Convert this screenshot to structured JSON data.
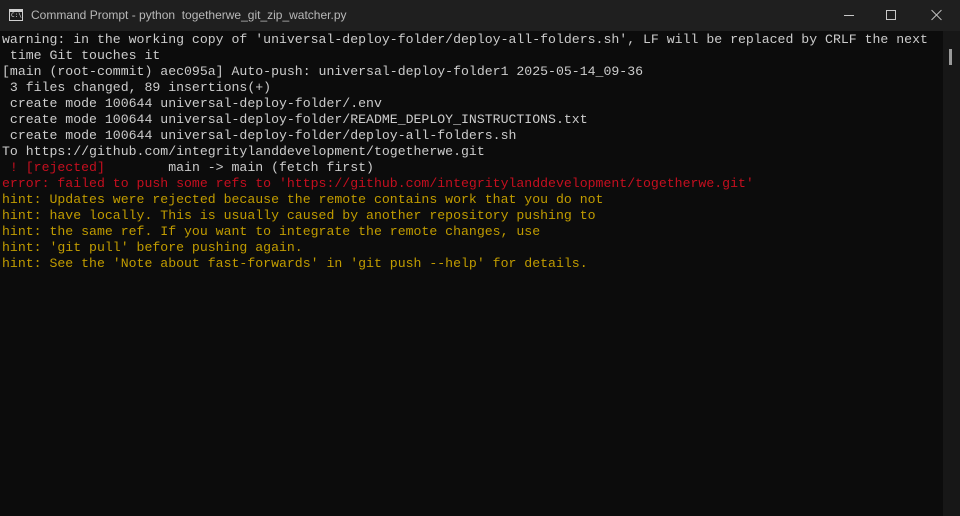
{
  "window": {
    "title": "Command Prompt - python  togetherwe_git_zip_watcher.py",
    "app_icon_text": "C:\\",
    "controls": [
      "minimize",
      "maximize",
      "close"
    ]
  },
  "console": {
    "lines": [
      {
        "text": "warning: in the working copy of 'universal-deploy-folder/deploy-all-folders.sh', LF will be replaced by CRLF the next",
        "color": "#cccccc"
      },
      {
        "text": " time Git touches it",
        "color": "#cccccc"
      },
      {
        "text": "[main (root-commit) aec095a] Auto-push: universal-deploy-folder1 2025-05-14_09-36",
        "color": "#cccccc"
      },
      {
        "text": " 3 files changed, 89 insertions(+)",
        "color": "#cccccc"
      },
      {
        "text": " create mode 100644 universal-deploy-folder/.env",
        "color": "#cccccc"
      },
      {
        "text": " create mode 100644 universal-deploy-folder/README_DEPLOY_INSTRUCTIONS.txt",
        "color": "#cccccc"
      },
      {
        "text": " create mode 100644 universal-deploy-folder/deploy-all-folders.sh",
        "color": "#cccccc"
      },
      {
        "text": "To https://github.com/integritylanddevelopment/togetherwe.git",
        "color": "#cccccc"
      },
      {
        "segments": [
          {
            "text": " ! [rejected]",
            "color": "#c50f1f"
          },
          {
            "text": "        main -> main (fetch first)",
            "color": "#cccccc"
          }
        ]
      },
      {
        "text": "error: failed to push some refs to 'https://github.com/integritylanddevelopment/togetherwe.git'",
        "color": "#c50f1f"
      },
      {
        "text": "hint: Updates were rejected because the remote contains work that you do not",
        "color": "#c19c00"
      },
      {
        "text": "hint: have locally. This is usually caused by another repository pushing to",
        "color": "#c19c00"
      },
      {
        "text": "hint: the same ref. If you want to integrate the remote changes, use",
        "color": "#c19c00"
      },
      {
        "text": "hint: 'git pull' before pushing again.",
        "color": "#c19c00"
      },
      {
        "text": "hint: See the 'Note about fast-forwards' in 'git push --help' for details.",
        "color": "#c19c00"
      }
    ]
  },
  "colors": {
    "background": "#0c0c0c",
    "titlebar": "#1f1f1f",
    "default_text": "#cccccc",
    "error_red": "#c50f1f",
    "hint_yellow": "#c19c00"
  }
}
